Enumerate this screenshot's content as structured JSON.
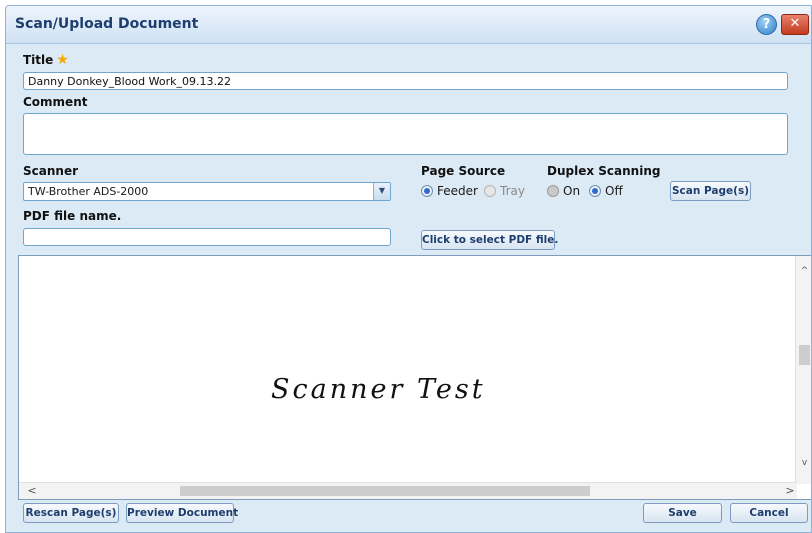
{
  "dialog": {
    "title": "Scan/Upload Document",
    "help_glyph": "?",
    "close_glyph": "✕"
  },
  "form": {
    "title_label": "Title",
    "title_star": "★",
    "title_value": "Danny Donkey_Blood Work_09.13.22",
    "comment_label": "Comment",
    "comment_value": "",
    "scanner_label": "Scanner",
    "scanner_value": "TW-Brother ADS-2000",
    "page_source_label": "Page Source",
    "page_source_options": [
      "Feeder",
      "Tray"
    ],
    "page_source_selected": "Feeder",
    "duplex_label": "Duplex Scanning",
    "duplex_options": [
      "On",
      "Off"
    ],
    "duplex_selected": "Off",
    "scan_button": "Scan Page(s)",
    "pdf_label": "PDF file name.",
    "pdf_value": "",
    "select_pdf_button": "Click to select PDF file."
  },
  "preview": {
    "handwriting": "Scanner Test"
  },
  "footer": {
    "rescan_button": "Rescan Page(s)",
    "preview_button": "Preview Document",
    "save_button": "Save",
    "cancel_button": "Cancel"
  },
  "icons": {
    "select_arrow": "▼",
    "scroll_up": "^",
    "scroll_down": "v",
    "scroll_left": "<",
    "scroll_right": ">"
  },
  "colors": {
    "dialog_bg": "#dceaf6",
    "title_text": "#1d3e6e",
    "accent_radio": "#2d6bd1",
    "close_red": "#c43b1f"
  }
}
